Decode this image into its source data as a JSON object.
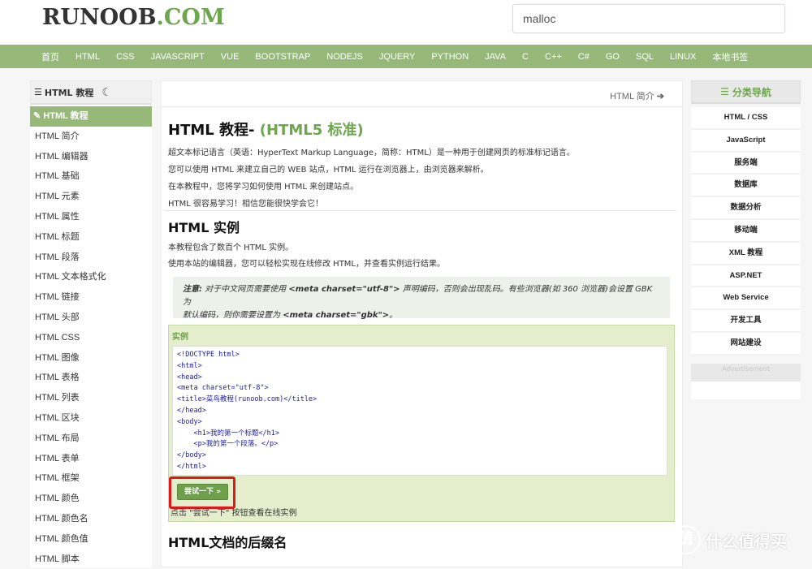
{
  "header": {
    "logo_main": "RUNOOB",
    "logo_com": ".COM",
    "search_value": "malloc"
  },
  "nav": [
    "首页",
    "HTML",
    "CSS",
    "JAVASCRIPT",
    "VUE",
    "BOOTSTRAP",
    "NODEJS",
    "JQUERY",
    "PYTHON",
    "JAVA",
    "C",
    "C++",
    "C#",
    "GO",
    "SQL",
    "LINUX",
    "本地书签"
  ],
  "left": {
    "title": "HTML 教程",
    "items": [
      "HTML 教程",
      "HTML 简介",
      "HTML 编辑器",
      "HTML 基础",
      "HTML 元素",
      "HTML 属性",
      "HTML 标题",
      "HTML 段落",
      "HTML 文本格式化",
      "HTML 链接",
      "HTML 头部",
      "HTML CSS",
      "HTML 图像",
      "HTML 表格",
      "HTML 列表",
      "HTML 区块",
      "HTML 布局",
      "HTML 表单",
      "HTML 框架",
      "HTML 颜色",
      "HTML 颜色名",
      "HTML 颜色值",
      "HTML 脚本"
    ]
  },
  "main": {
    "crumb": "HTML 简介",
    "title": "HTML 教程-",
    "title_sub": "(HTML5 标准)",
    "intro": [
      "超文本标记语言（英语：HyperText Markup Language，简称：HTML）是一种用于创建网页的标准标记语言。",
      "您可以使用 HTML 来建立自己的 WEB 站点，HTML 运行在浏览器上，由浏览器来解析。",
      "在本教程中，您将学习如何使用 HTML 来创建站点。",
      "HTML 很容易学习！相信您能很快学会它！"
    ],
    "h2_examples": "HTML 实例",
    "examples_text": [
      "本教程包含了数百个 HTML 实例。",
      "使用本站的编辑器，您可以轻松实现在线修改 HTML，并查看实例运行结果。"
    ],
    "note_label": "注意:",
    "note_text_1": " 对于中文网页需要使用 ",
    "note_code_1": "<meta charset=\"utf-8\">",
    "note_text_2": " 声明编码，否则会出现乱码。有些浏览器(如 360 浏览器)会设置 GBK 为",
    "note_text_3": "默认编码，则你需要设置为 ",
    "note_code_2": "<meta charset=\"gbk\">",
    "note_text_4": "。",
    "example_title": "实例",
    "code_lines": [
      "<!DOCTYPE html>",
      "<html>",
      "<head>",
      "<meta charset=\"utf-8\">",
      "<title>菜鸟教程(runoob.com)</title>",
      "</head>",
      "<body>",
      "    <h1>我的第一个标题</h1>",
      "    <p>我的第一个段落。</p>",
      "</body>",
      "</html>"
    ],
    "try_button": "尝试一下 »",
    "try_hint": "点击 \"尝试一下\" 按钮查看在线实例",
    "h2_suffix": "HTML文档的后缀名"
  },
  "right": {
    "title": "分类导航",
    "items": [
      "HTML / CSS",
      "JavaScript",
      "服务端",
      "数据库",
      "数据分析",
      "移动端",
      "XML 教程",
      "ASP.NET",
      "Web Service",
      "开发工具",
      "网站建设"
    ],
    "ad": "Advertisement"
  },
  "watermark": {
    "symbol": "值",
    "text": "什么值得买"
  }
}
